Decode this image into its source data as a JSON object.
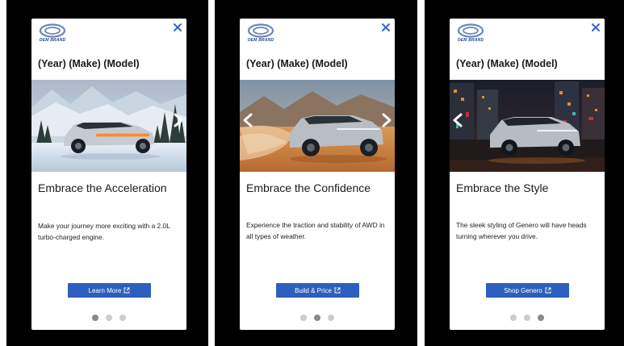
{
  "brand": {
    "logo_text": "OEM BRAND"
  },
  "colors": {
    "accent": "#2c5fbd",
    "dot_active": "#8a8a8a",
    "dot_inactive": "#cdcdcd",
    "panel_bg": "#000000"
  },
  "cards": [
    {
      "title": "(Year) (Make) (Model)",
      "headline": "Embrace the Acceleration",
      "body": "Make your journey more exciting with a 2.0L turbo-charged engine.",
      "cta_label": "Learn More",
      "arrows": [
        "next"
      ],
      "active_dot": 1,
      "scene": "snowy forest"
    },
    {
      "title": "(Year) (Make) (Model)",
      "headline": "Embrace the Confidence",
      "body": "Experience the traction and stability of AWD in all types of weather.",
      "cta_label": "Build & Price",
      "arrows": [
        "prev",
        "next"
      ],
      "active_dot": 2,
      "scene": "desert dust"
    },
    {
      "title": "(Year) (Make) (Model)",
      "headline": "Embrace the Style",
      "body": "The sleek styling of Genero will have heads turning wherever you drive.",
      "cta_label": "Shop Genero",
      "arrows": [
        "prev"
      ],
      "active_dot": 3,
      "scene": "city night"
    }
  ],
  "icons": {
    "close": "close-icon",
    "next": "chevron-right-icon",
    "prev": "chevron-left-icon",
    "external": "external-link-icon",
    "logo": "brand-logo"
  }
}
